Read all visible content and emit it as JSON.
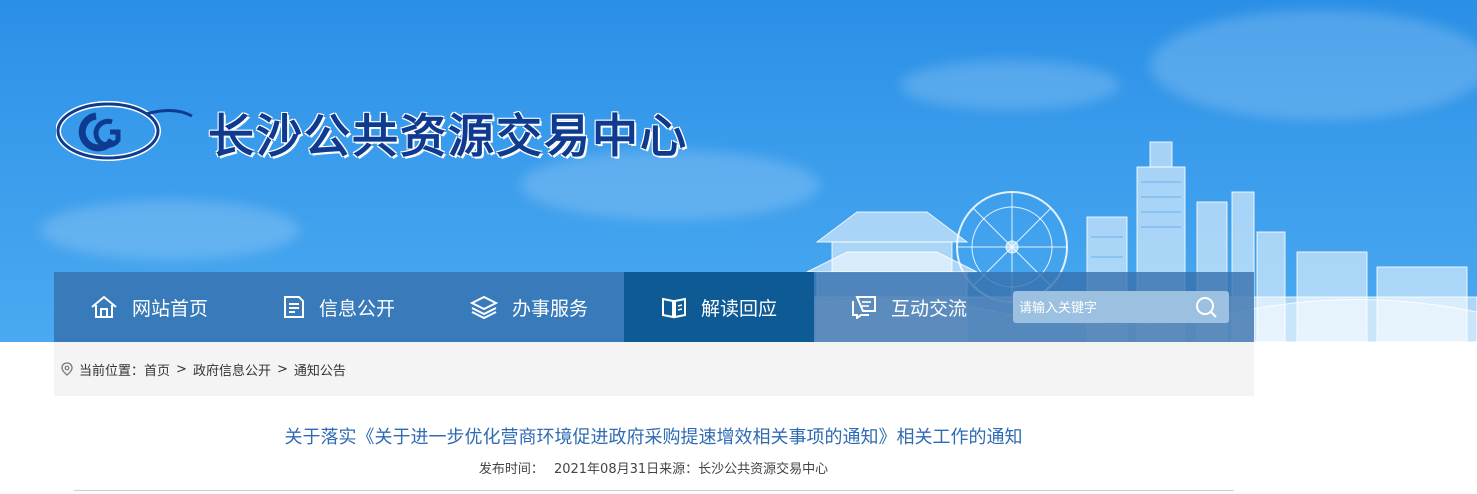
{
  "header": {
    "site_title": "长沙公共资源交易中心",
    "logo_letters": "CG"
  },
  "nav": {
    "items": [
      {
        "label": "网站首页",
        "icon": "home-icon"
      },
      {
        "label": "信息公开",
        "icon": "document-icon"
      },
      {
        "label": "办事服务",
        "icon": "layers-icon"
      },
      {
        "label": "解读回应",
        "icon": "book-icon",
        "active": true
      },
      {
        "label": "互动交流",
        "icon": "chat-icon"
      }
    ],
    "search_placeholder": "请输入关键字"
  },
  "breadcrumb": {
    "prefix": "当前位置：",
    "items": [
      "首页",
      "政府信息公开",
      "通知公告"
    ],
    "separator": ">"
  },
  "article": {
    "title": "关于落实《关于进一步优化营商环境促进政府采购提速增效相关事项的通知》相关工作的通知",
    "meta_label": "发布时间：",
    "date": "2021年08月31日",
    "source_label": "来源：",
    "source": "长沙公共资源交易中心"
  },
  "colors": {
    "banner_blue": "#2a8fe6",
    "nav_bg": "#346eaa",
    "nav_active": "#0d5a94",
    "title_navy": "#0e3b8f",
    "article_title": "#2e6bb3"
  }
}
